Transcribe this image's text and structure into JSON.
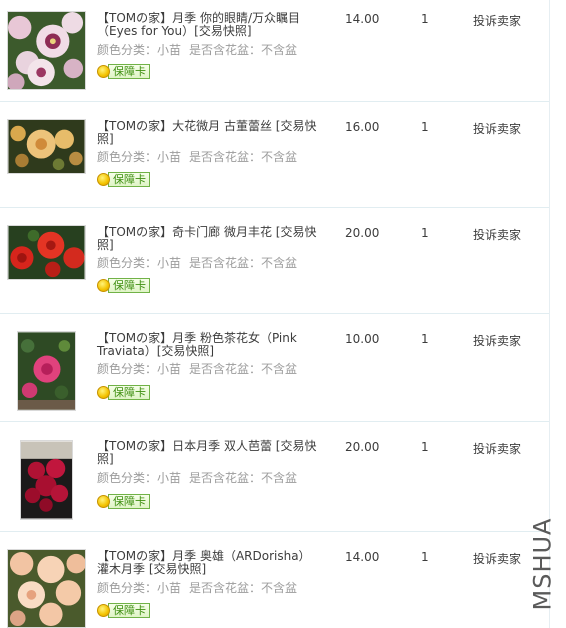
{
  "orders": [
    {
      "title": "【TOMの家】月季 你的眼睛/万众瞩目（Eyes for You）[交易快照]",
      "color_category": "颜色分类：小苗",
      "pot_option": "是否含花盆：不含盆",
      "guarantee_label": "保障卡",
      "price": "14.00",
      "quantity": "1",
      "complain_label": "投诉卖家"
    },
    {
      "title": "【TOMの家】大花微月 古董蕾丝 [交易快照]",
      "color_category": "颜色分类：小苗",
      "pot_option": "是否含花盆：不含盆",
      "guarantee_label": "保障卡",
      "price": "16.00",
      "quantity": "1",
      "complain_label": "投诉卖家"
    },
    {
      "title": "【TOMの家】奇卡门廊 微月丰花 [交易快照]",
      "color_category": "颜色分类：小苗",
      "pot_option": "是否含花盆：不含盆",
      "guarantee_label": "保障卡",
      "price": "20.00",
      "quantity": "1",
      "complain_label": "投诉卖家"
    },
    {
      "title": "【TOMの家】月季 粉色茶花女（Pink Traviata）[交易快照]",
      "color_category": "颜色分类：小苗",
      "pot_option": "是否含花盆：不含盆",
      "guarantee_label": "保障卡",
      "price": "10.00",
      "quantity": "1",
      "complain_label": "投诉卖家"
    },
    {
      "title": "【TOMの家】日本月季 双人芭蕾 [交易快照]",
      "color_category": "颜色分类：小苗",
      "pot_option": "是否含花盆：不含盆",
      "guarantee_label": "保障卡",
      "price": "20.00",
      "quantity": "1",
      "complain_label": "投诉卖家"
    },
    {
      "title": "【TOMの家】月季 奥雄（ARDorisha）灌木月季 [交易快照]",
      "color_category": "颜色分类：小苗",
      "pot_option": "是否含花盆：不含盆",
      "guarantee_label": "保障卡",
      "price": "14.00",
      "quantity": "1",
      "complain_label": "投诉卖家"
    }
  ],
  "watermark": "MSHUA",
  "colors": {
    "title_text": "#3c3c3c",
    "spec_text": "#9c9c9c",
    "badge_green": "#3f8f12",
    "divider": "#e1edf1"
  }
}
